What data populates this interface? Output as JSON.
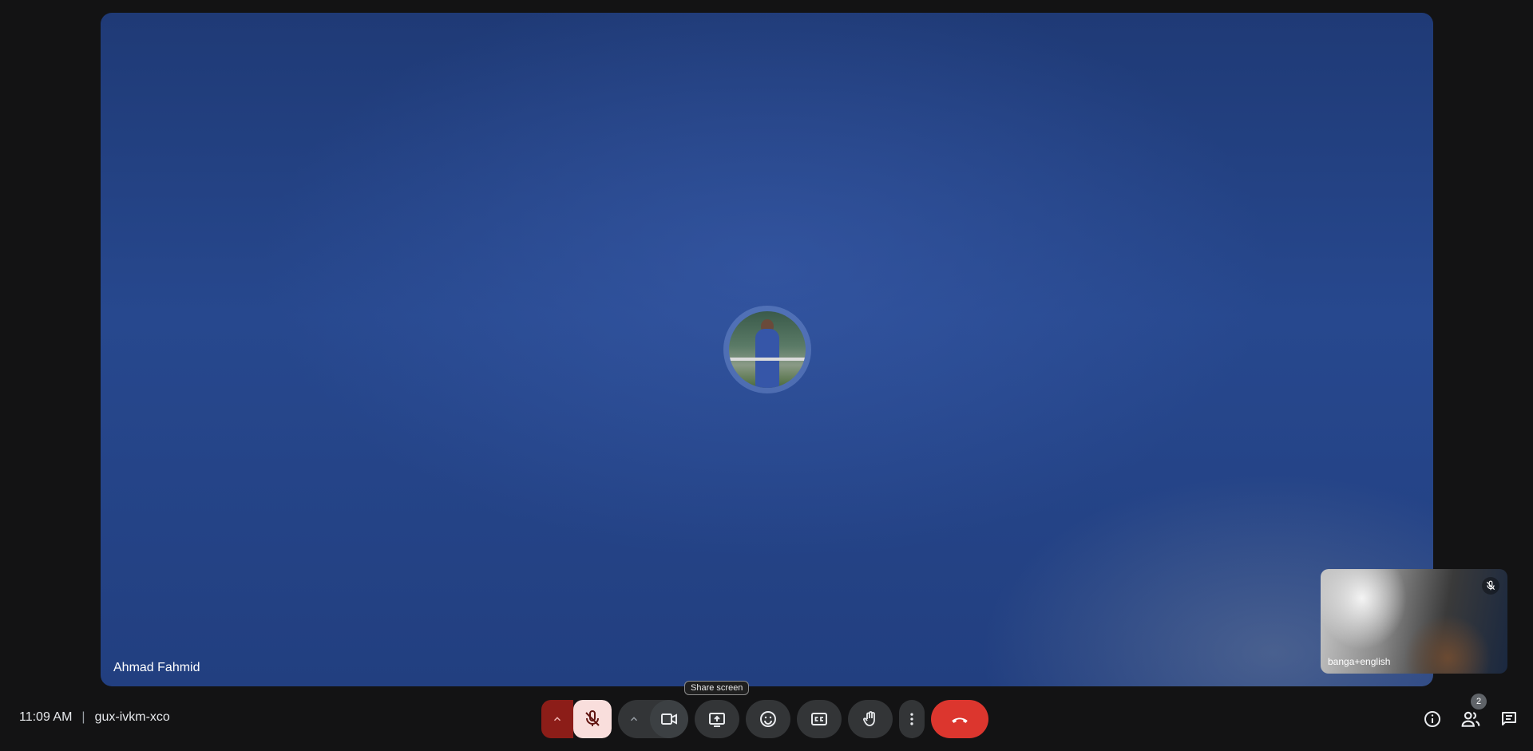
{
  "meeting": {
    "time": "11:09 AM",
    "separator": "|",
    "code": "gux-ivkm-xco"
  },
  "main_tile": {
    "participant_name": "Ahmad Fahmid"
  },
  "self_tile": {
    "label": "banga+english"
  },
  "tooltip": {
    "text": "Share screen"
  },
  "controls": {
    "mic_state": "muted",
    "leave_color": "#dc362e"
  },
  "people": {
    "count": "2"
  },
  "colors": {
    "background": "#131314",
    "stage": "#27488e",
    "mic_muted": "#f9dedc",
    "mic_caret": "#8c1d18"
  }
}
